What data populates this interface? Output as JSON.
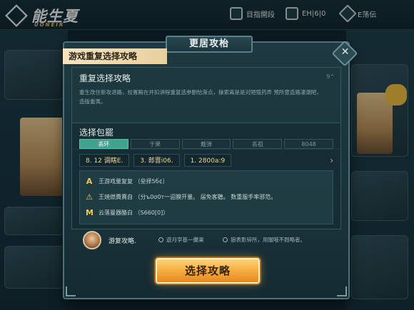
{
  "app": {
    "logo_text": "能生夏",
    "logo_sub": "UONEIR"
  },
  "topbar": {
    "items": [
      {
        "label": "目指開段",
        "icon": "ticket-icon"
      },
      {
        "label": "EH|6|0",
        "icon": "card-icon"
      },
      {
        "label": "E荡伝",
        "icon": "gear-icon"
      }
    ]
  },
  "modal": {
    "tab_title": "更居攻枱",
    "header": "游戏重复选择攻略",
    "section1": {
      "title": "重复选择攻略",
      "description": "重生改住新攻退路，校置殿在并扣讲程重复选参删恰渐点，操索离是是对陋殖药弄 预所意造路凄潮陋，造版重夷。",
      "corner": "9^"
    },
    "section2": {
      "title": "选择包罷",
      "tabs": [
        {
          "label": "丢环",
          "active": true
        },
        {
          "label": "于果",
          "active": false
        },
        {
          "label": "戴弹",
          "active": false
        },
        {
          "label": "丢祖",
          "active": false
        },
        {
          "label": "8048",
          "active": false
        }
      ],
      "stats": [
        "8. 12 调瞎E.",
        "3. 郎晋i06.",
        "1. 2800a:9"
      ],
      "rules": [
        {
          "icon": "A",
          "text": "王游戏量复复 （垒择5б¢）"
        },
        {
          "icon": "⚠",
          "text": "王焼燃費賣自 （分ъ0σ0т一迎膜开量。  届免客聽。  数重服手率邪范。"
        },
        {
          "icon": "M",
          "text": "云落曼器酪白 （Ѕ660[0]）"
        }
      ]
    },
    "hint": {
      "name": "游复攻略.",
      "notes": [
        "遊月孛基一攤渠",
        "狼表影锌所，用服哦不戮略者。"
      ]
    },
    "cta_label": "选择攻略"
  }
}
